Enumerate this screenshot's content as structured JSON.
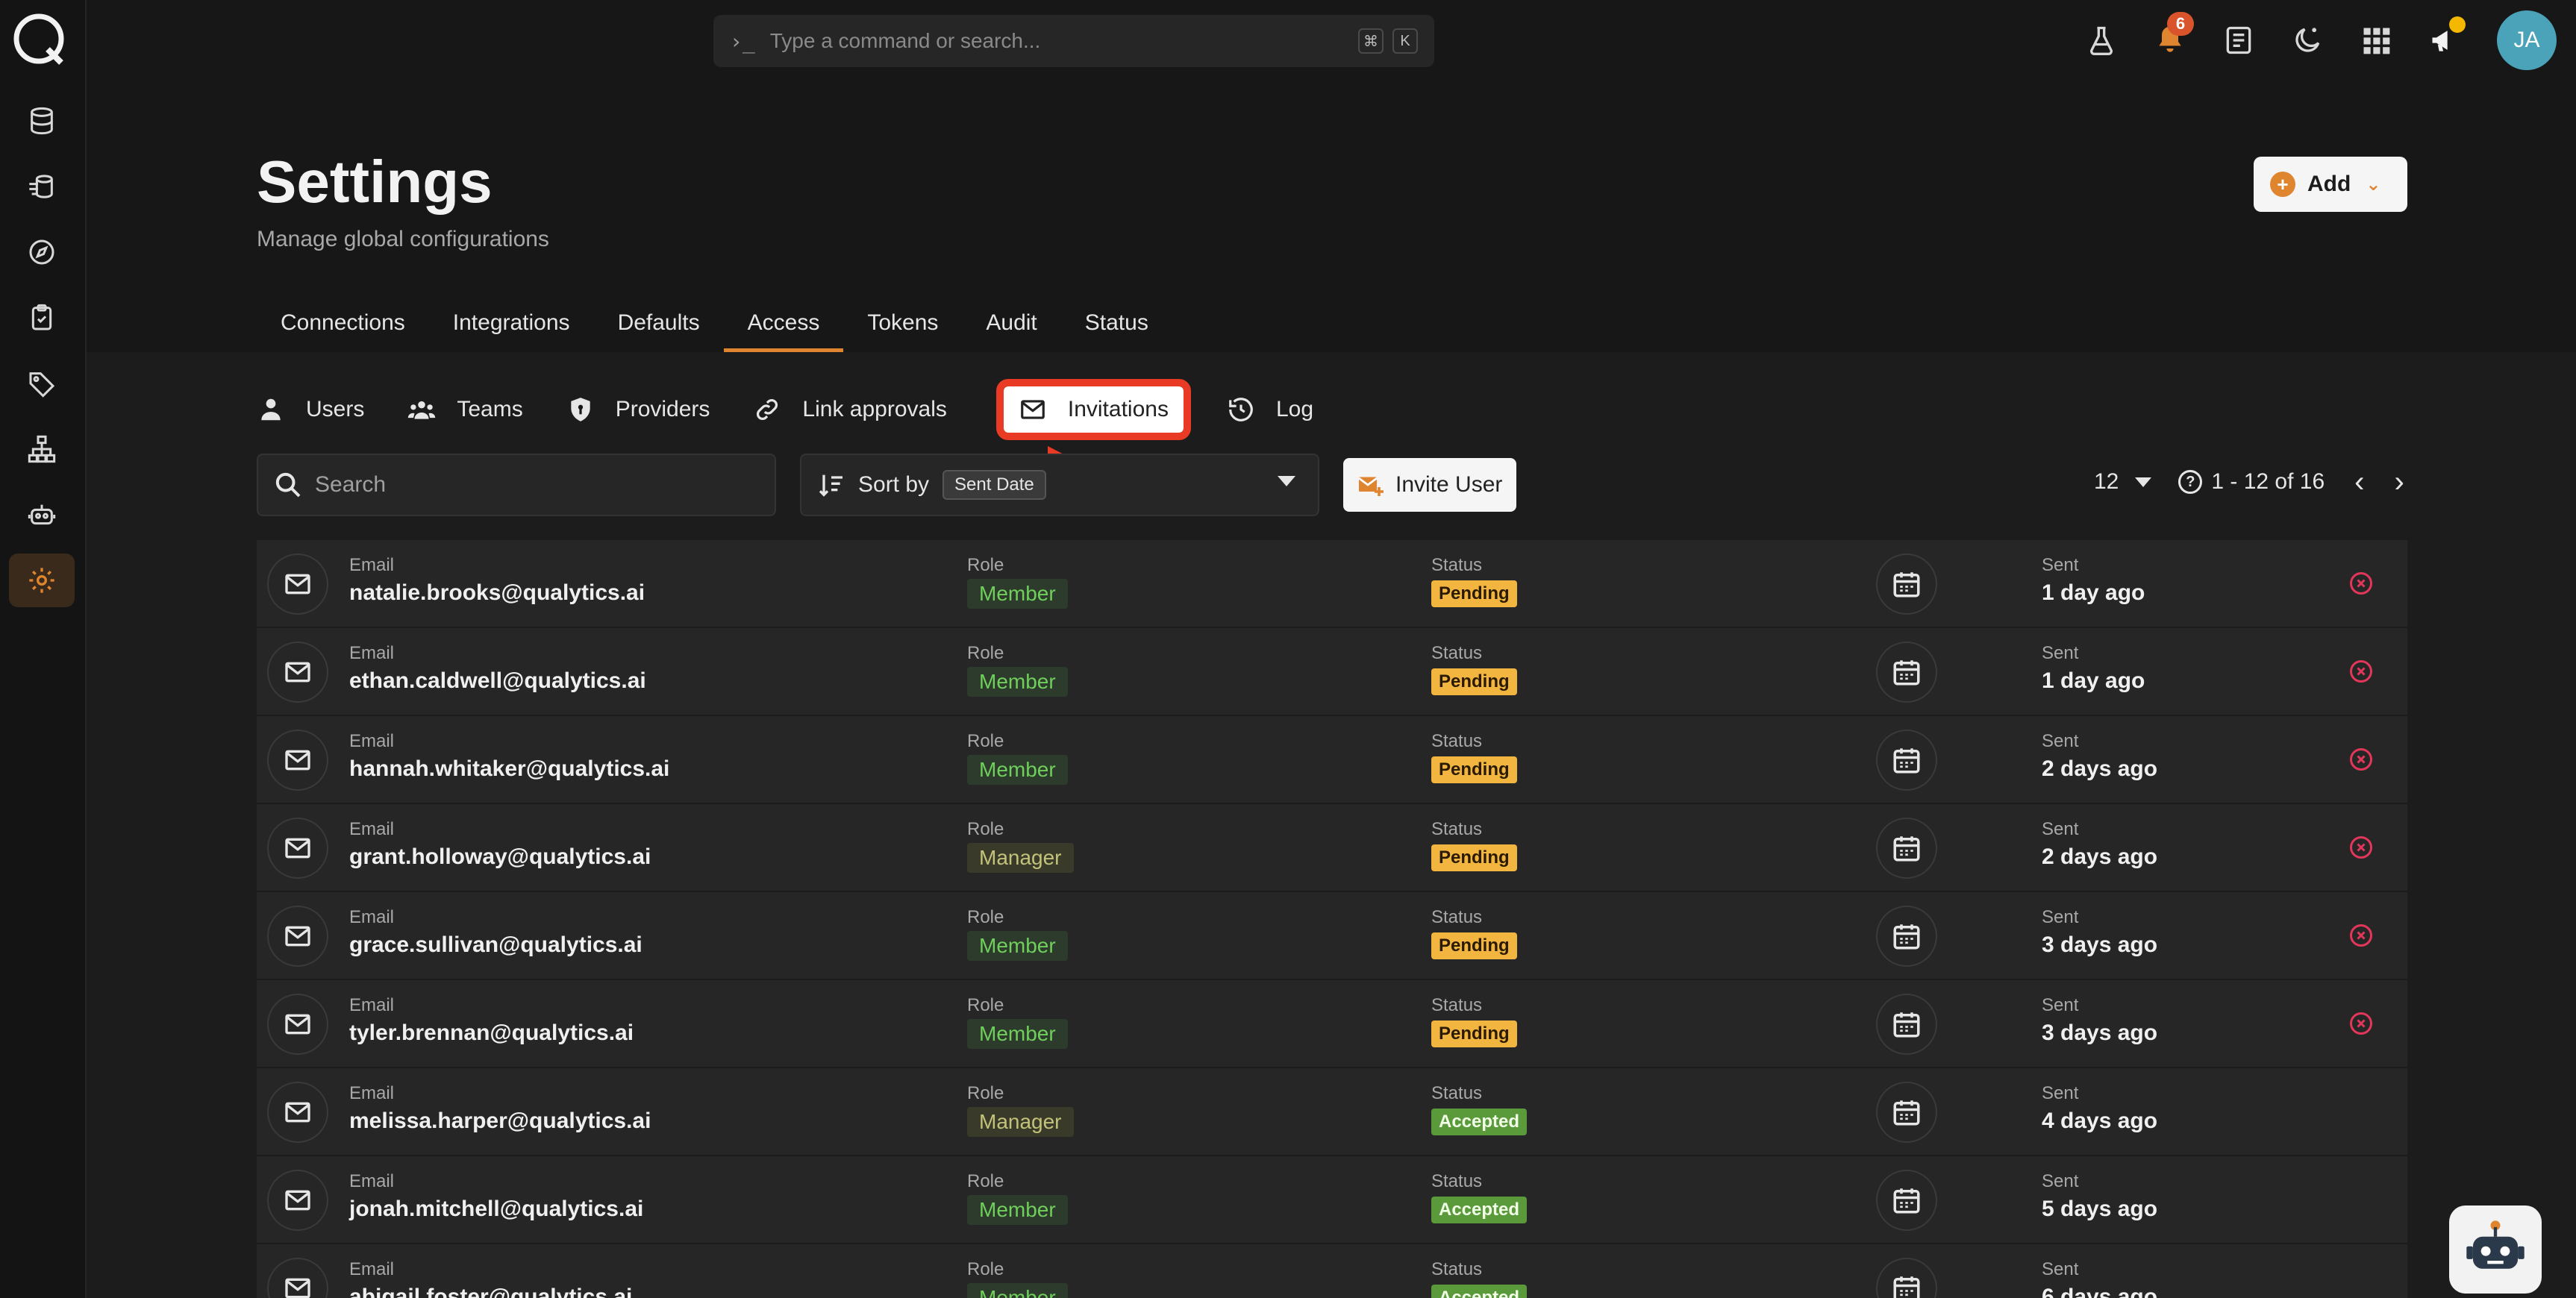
{
  "command_bar": {
    "prompt": "›_",
    "placeholder": "Type a command or search...",
    "key1": "⌘",
    "key2": "K"
  },
  "notifications": {
    "count": "6"
  },
  "user": {
    "initials": "JA"
  },
  "page": {
    "title": "Settings",
    "subtitle": "Manage global configurations",
    "add_label": "Add"
  },
  "tabs": [
    {
      "label": "Connections"
    },
    {
      "label": "Integrations"
    },
    {
      "label": "Defaults"
    },
    {
      "label": "Access"
    },
    {
      "label": "Tokens"
    },
    {
      "label": "Audit"
    },
    {
      "label": "Status"
    }
  ],
  "subtabs": [
    {
      "label": "Users"
    },
    {
      "label": "Teams"
    },
    {
      "label": "Providers"
    },
    {
      "label": "Link approvals"
    },
    {
      "label": "Invitations"
    },
    {
      "label": "Log"
    }
  ],
  "toolbar": {
    "search_placeholder": "Search",
    "sort_label": "Sort by",
    "sort_value": "Sent Date",
    "invite_label": "Invite User"
  },
  "pagination": {
    "per_page": "12",
    "range": "1 - 12 of 16"
  },
  "columns": {
    "email": "Email",
    "role": "Role",
    "status": "Status",
    "sent": "Sent"
  },
  "rows": [
    {
      "email": "natalie.brooks@qualytics.ai",
      "role": "Member",
      "status": "Pending",
      "sent": "1 day ago"
    },
    {
      "email": "ethan.caldwell@qualytics.ai",
      "role": "Member",
      "status": "Pending",
      "sent": "1 day ago"
    },
    {
      "email": "hannah.whitaker@qualytics.ai",
      "role": "Member",
      "status": "Pending",
      "sent": "2 days ago"
    },
    {
      "email": "grant.holloway@qualytics.ai",
      "role": "Manager",
      "status": "Pending",
      "sent": "2 days ago"
    },
    {
      "email": "grace.sullivan@qualytics.ai",
      "role": "Member",
      "status": "Pending",
      "sent": "3 days ago"
    },
    {
      "email": "tyler.brennan@qualytics.ai",
      "role": "Member",
      "status": "Pending",
      "sent": "3 days ago"
    },
    {
      "email": "melissa.harper@qualytics.ai",
      "role": "Manager",
      "status": "Accepted",
      "sent": "4 days ago"
    },
    {
      "email": "jonah.mitchell@qualytics.ai",
      "role": "Member",
      "status": "Accepted",
      "sent": "5 days ago"
    },
    {
      "email": "abigail.foster@qualytics.ai",
      "role": "Member",
      "status": "Accepted",
      "sent": "6 days ago"
    }
  ],
  "colors": {
    "accent": "#e0852f",
    "highlight": "#e83a24",
    "pending": "#f2b640",
    "accepted": "#5a9a3a"
  }
}
